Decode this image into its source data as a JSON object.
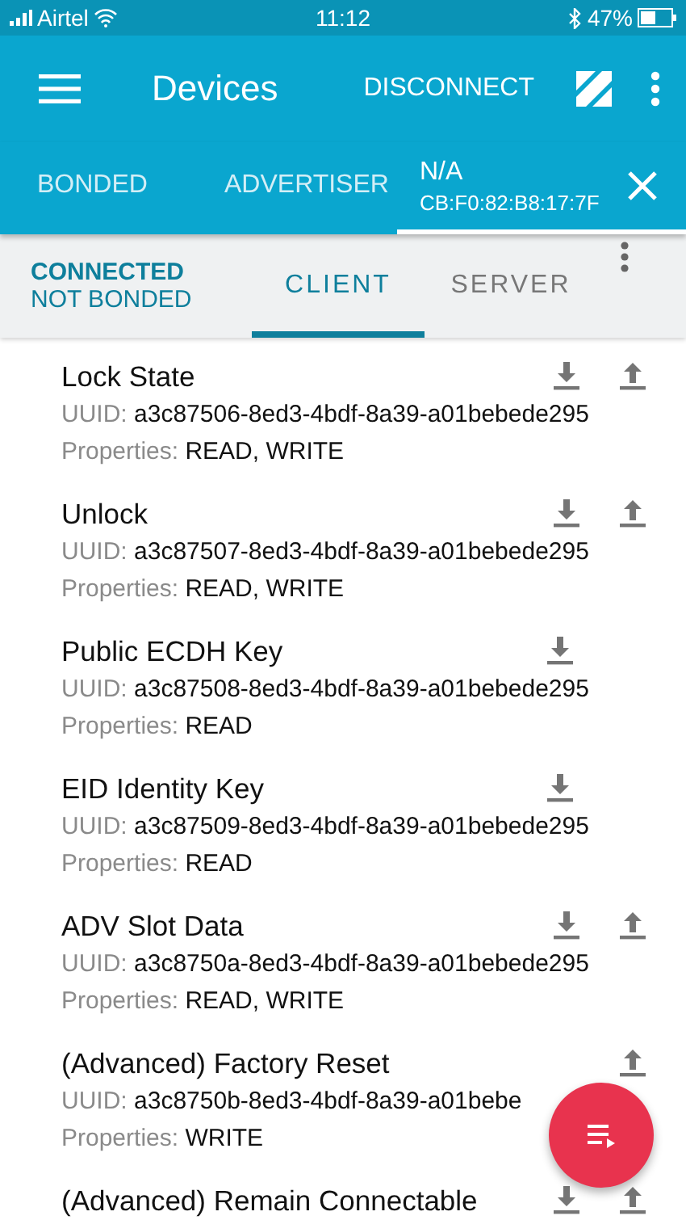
{
  "status_bar": {
    "carrier": "Airtel",
    "time": "11:12",
    "battery": "47%"
  },
  "app_bar": {
    "title": "Devices",
    "action": "DISCONNECT"
  },
  "tabs": [
    {
      "label": "BONDED",
      "selected": false
    },
    {
      "label": "ADVERTISER",
      "selected": false
    },
    {
      "label": "N/A",
      "address": "CB:F0:82:B8:17:7F",
      "selected": true
    }
  ],
  "connection": {
    "state": "CONNECTED",
    "bond": "NOT BONDED"
  },
  "sub_tabs": [
    {
      "label": "CLIENT",
      "selected": true
    },
    {
      "label": "SERVER",
      "selected": false
    }
  ],
  "characteristics": [
    {
      "name": "Lock State",
      "uuid_label": "UUID:",
      "uuid": "a3c87506-8ed3-4bdf-8a39-a01bebede295",
      "properties_label": "Properties:",
      "properties": "READ, WRITE",
      "readable": true,
      "writable": true
    },
    {
      "name": "Unlock",
      "uuid_label": "UUID:",
      "uuid": "a3c87507-8ed3-4bdf-8a39-a01bebede295",
      "properties_label": "Properties:",
      "properties": "READ, WRITE",
      "readable": true,
      "writable": true
    },
    {
      "name": "Public ECDH Key",
      "uuid_label": "UUID:",
      "uuid": "a3c87508-8ed3-4bdf-8a39-a01bebede295",
      "properties_label": "Properties:",
      "properties": "READ",
      "readable": true,
      "writable": false
    },
    {
      "name": "EID Identity Key",
      "uuid_label": "UUID:",
      "uuid": "a3c87509-8ed3-4bdf-8a39-a01bebede295",
      "properties_label": "Properties:",
      "properties": "READ",
      "readable": true,
      "writable": false
    },
    {
      "name": "ADV Slot Data",
      "uuid_label": "UUID:",
      "uuid": "a3c8750a-8ed3-4bdf-8a39-a01bebede295",
      "properties_label": "Properties:",
      "properties": "READ, WRITE",
      "readable": true,
      "writable": true
    },
    {
      "name": "(Advanced) Factory Reset",
      "uuid_label": "UUID:",
      "uuid": "a3c8750b-8ed3-4bdf-8a39-a01bebe",
      "properties_label": "Properties:",
      "properties": "WRITE",
      "readable": false,
      "writable": true
    },
    {
      "name": "(Advanced) Remain Connectable",
      "readable": true,
      "writable": true
    }
  ]
}
